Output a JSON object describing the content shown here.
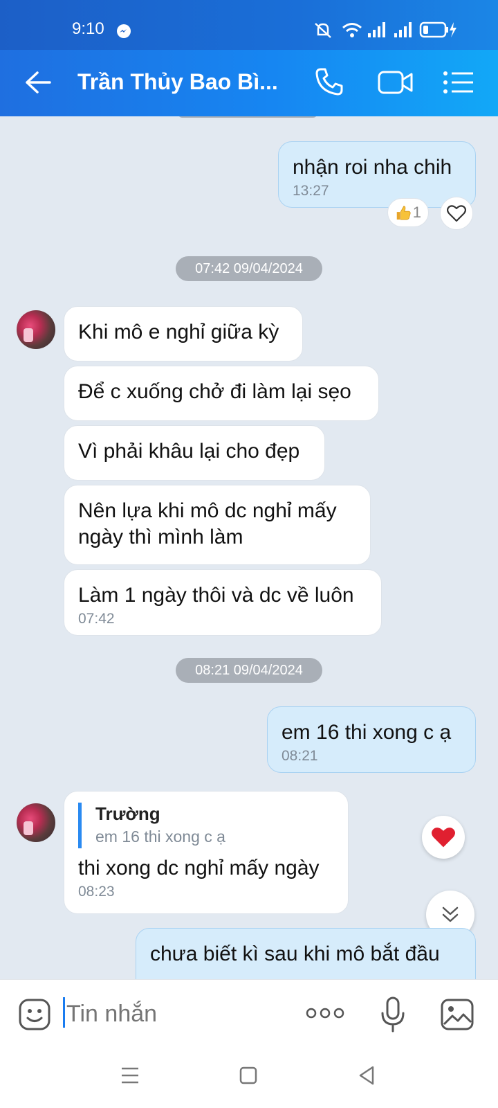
{
  "status_bar": {
    "time": "9:10"
  },
  "header": {
    "title": "Trần Thủy Bao Bì..."
  },
  "messages": [
    {
      "side": "me",
      "text": "nhận roi nha chih",
      "time": "13:27",
      "reaction_count": "1"
    },
    {
      "date_chip": "07:42 09/04/2024"
    },
    {
      "side": "them",
      "text": "Khi mô e nghỉ giữa kỳ"
    },
    {
      "side": "them",
      "text": "Để c xuống chở đi làm lại sẹo"
    },
    {
      "side": "them",
      "text": "Vì phải khâu lại cho đẹp"
    },
    {
      "side": "them",
      "text": "Nên lựa khi mô dc nghỉ mấy ngày thì mình làm"
    },
    {
      "side": "them",
      "text": "Làm 1 ngày thôi và dc về luôn",
      "time": "07:42"
    },
    {
      "date_chip": "08:21 09/04/2024"
    },
    {
      "side": "me",
      "text": "em 16 thi xong c ạ",
      "time": "08:21"
    },
    {
      "side": "them",
      "quote_name": "Trường",
      "quote_text": "em 16 thi xong c ạ",
      "text": "thi xong dc nghỉ mấy ngày",
      "time": "08:23"
    },
    {
      "side": "me",
      "text": "chưa biết kì sau khi mô bắt đầu"
    }
  ],
  "input": {
    "placeholder": "Tin nhắn"
  },
  "colors": {
    "header_start": "#1f6fe0",
    "header_end": "#12a8f7",
    "chat_bg": "#e2e9f1",
    "my_bubble": "#d6ecfb",
    "their_bubble": "#ffffff",
    "accent": "#1a7cf0",
    "heart": "#e02030"
  },
  "icons": [
    "back-arrow-icon",
    "phone-icon",
    "video-call-icon",
    "menu-list-icon",
    "thumbs-up-icon",
    "heart-outline-icon",
    "heart-filled-icon",
    "scroll-down-icon",
    "sticker-icon",
    "more-icon",
    "microphone-icon",
    "image-icon"
  ]
}
